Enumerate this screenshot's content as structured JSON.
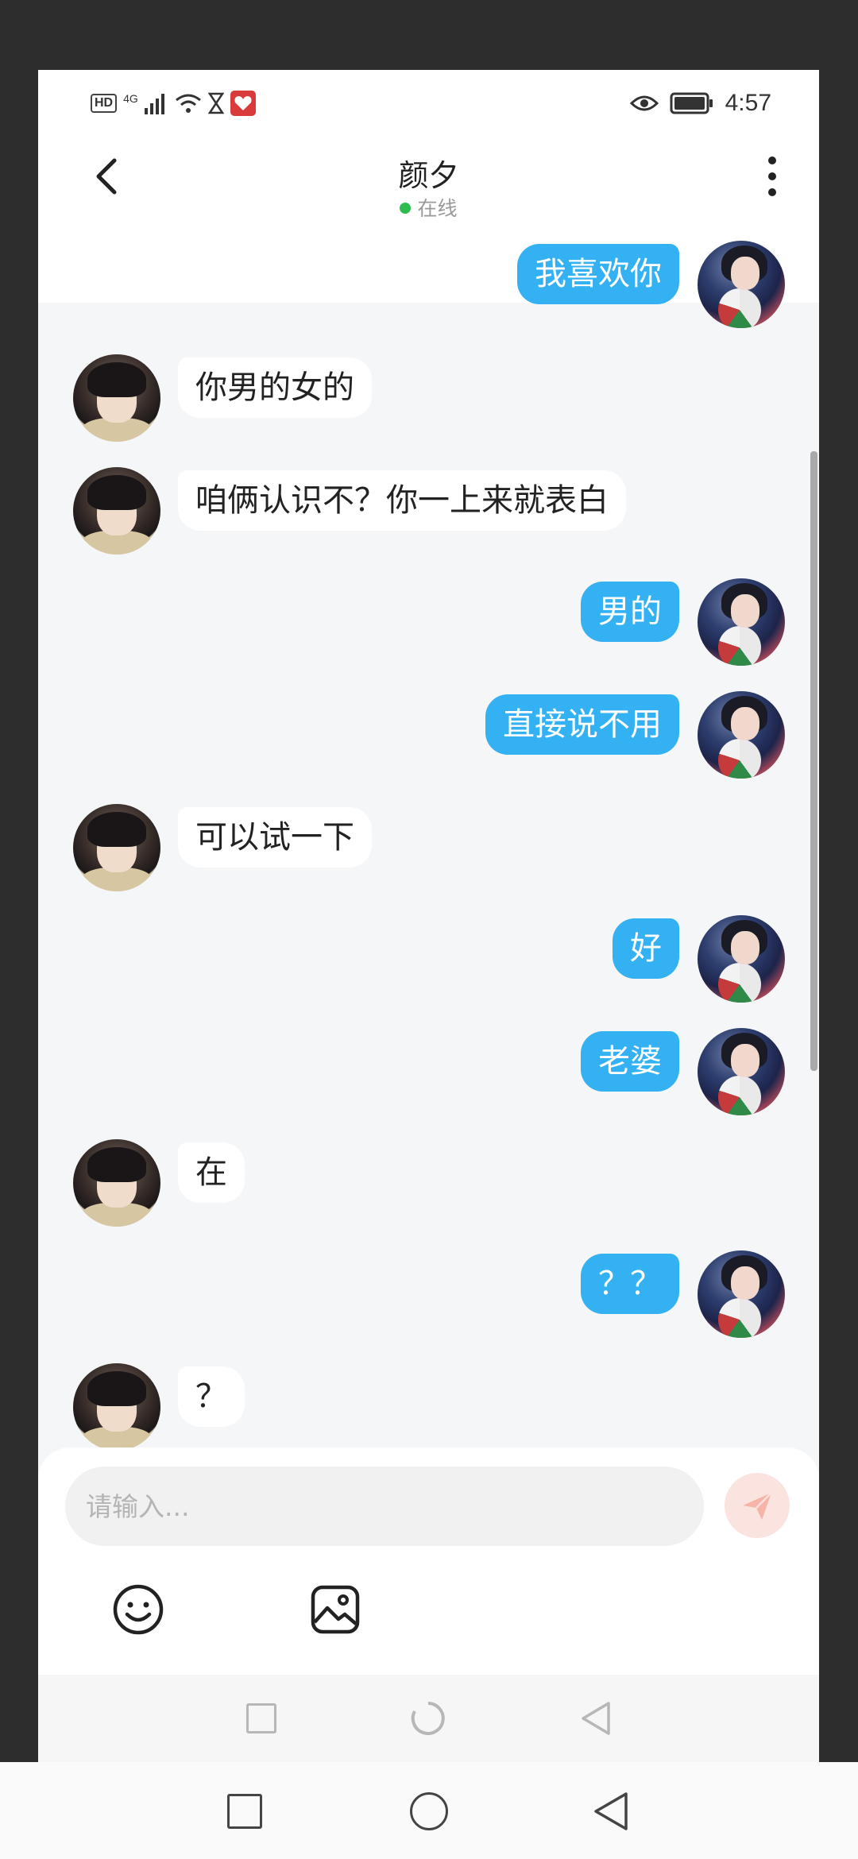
{
  "statusbar": {
    "hd_badge": "HD",
    "network": "4G",
    "time": "4:57"
  },
  "header": {
    "title": "颜夕",
    "status": "在线",
    "status_color": "#2dbd4e"
  },
  "messages": [
    {
      "from": "me",
      "text": "我喜欢你"
    },
    {
      "from": "other",
      "text": "你男的女的"
    },
    {
      "from": "other",
      "text": "咱俩认识不？你一上来就表白"
    },
    {
      "from": "me",
      "text": "男的"
    },
    {
      "from": "me",
      "text": "直接说不用"
    },
    {
      "from": "other",
      "text": "可以试一下"
    },
    {
      "from": "me",
      "text": "好"
    },
    {
      "from": "me",
      "text": "老婆"
    },
    {
      "from": "other",
      "text": "在"
    },
    {
      "from": "me",
      "text": "？？"
    },
    {
      "from": "other",
      "text": "？"
    }
  ],
  "composer": {
    "placeholder": "请输入...",
    "value": "",
    "send_icon": "send-icon",
    "tools": [
      "emoji-icon",
      "image-icon"
    ]
  },
  "colors": {
    "my_bubble": "#33b1f2",
    "other_bubble": "#ffffff",
    "chat_background": "#f4f6f8"
  },
  "navbar": {
    "buttons": [
      "recent-apps-icon",
      "home-icon",
      "back-icon"
    ]
  }
}
